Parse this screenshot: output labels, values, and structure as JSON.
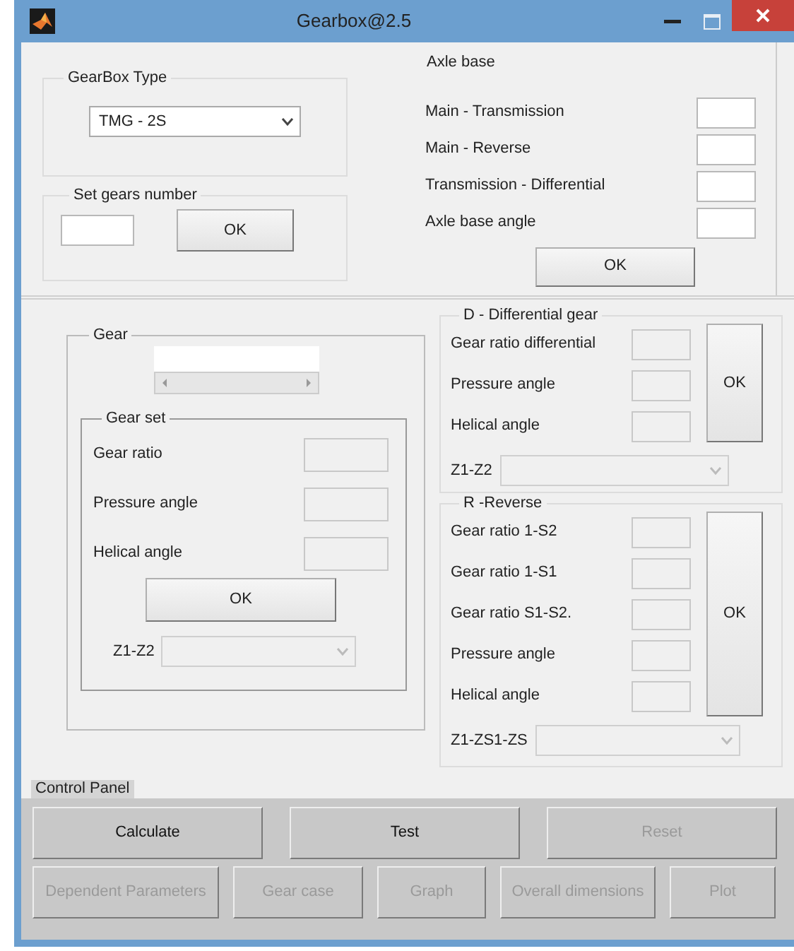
{
  "window": {
    "title": "Gearbox@2.5"
  },
  "gearbox_type": {
    "legend": "GearBox Type",
    "value": "TMG - 2S"
  },
  "set_gears_number": {
    "legend": "Set gears number",
    "button": "OK"
  },
  "axle_base": {
    "title": "Axle base",
    "fields": [
      {
        "label": "Main - Transmission"
      },
      {
        "label": "Main - Reverse"
      },
      {
        "label": "Transmission - Differential"
      },
      {
        "label": "Axle base angle"
      }
    ],
    "button": "OK"
  },
  "gear": {
    "legend": "Gear",
    "gear_set": {
      "legend": "Gear set",
      "fields": [
        {
          "label": "Gear ratio",
          "disabled": true
        },
        {
          "label": "Pressure angle",
          "disabled": true
        },
        {
          "label": "Helical angle",
          "disabled": true
        }
      ],
      "button": "OK",
      "selector": {
        "label": "Z1-Z2",
        "disabled": true
      }
    }
  },
  "differential": {
    "legend": "D - Differential gear",
    "fields": [
      {
        "label": "Gear ratio differential",
        "disabled": true
      },
      {
        "label": "Pressure angle",
        "disabled": true
      },
      {
        "label": "Helical angle",
        "disabled": true
      }
    ],
    "button": "OK",
    "selector": {
      "label": "Z1-Z2",
      "disabled": true
    }
  },
  "reverse": {
    "legend": "R -Reverse",
    "fields": [
      {
        "label": "Gear ratio 1-S2",
        "disabled": true
      },
      {
        "label": "Gear ratio 1-S1",
        "disabled": true
      },
      {
        "label": "Gear ratio S1-S2.",
        "disabled": true
      },
      {
        "label": "Pressure angle",
        "disabled": true
      },
      {
        "label": "Helical angle",
        "disabled": true
      }
    ],
    "button": "OK",
    "selector": {
      "label": "Z1-ZS1-ZS",
      "disabled": true
    }
  },
  "control_panel": {
    "label": "Control Panel",
    "rows": [
      [
        {
          "label": "Calculate",
          "disabled": false
        },
        {
          "label": "Test",
          "disabled": false
        },
        {
          "label": "Reset",
          "disabled": true
        }
      ],
      [
        {
          "label": "Dependent Parameters",
          "disabled": true
        },
        {
          "label": "Gear case",
          "disabled": true
        },
        {
          "label": "Graph",
          "disabled": true
        },
        {
          "label": "Overall dimensions",
          "disabled": true
        },
        {
          "label": "Plot",
          "disabled": true
        }
      ]
    ]
  }
}
